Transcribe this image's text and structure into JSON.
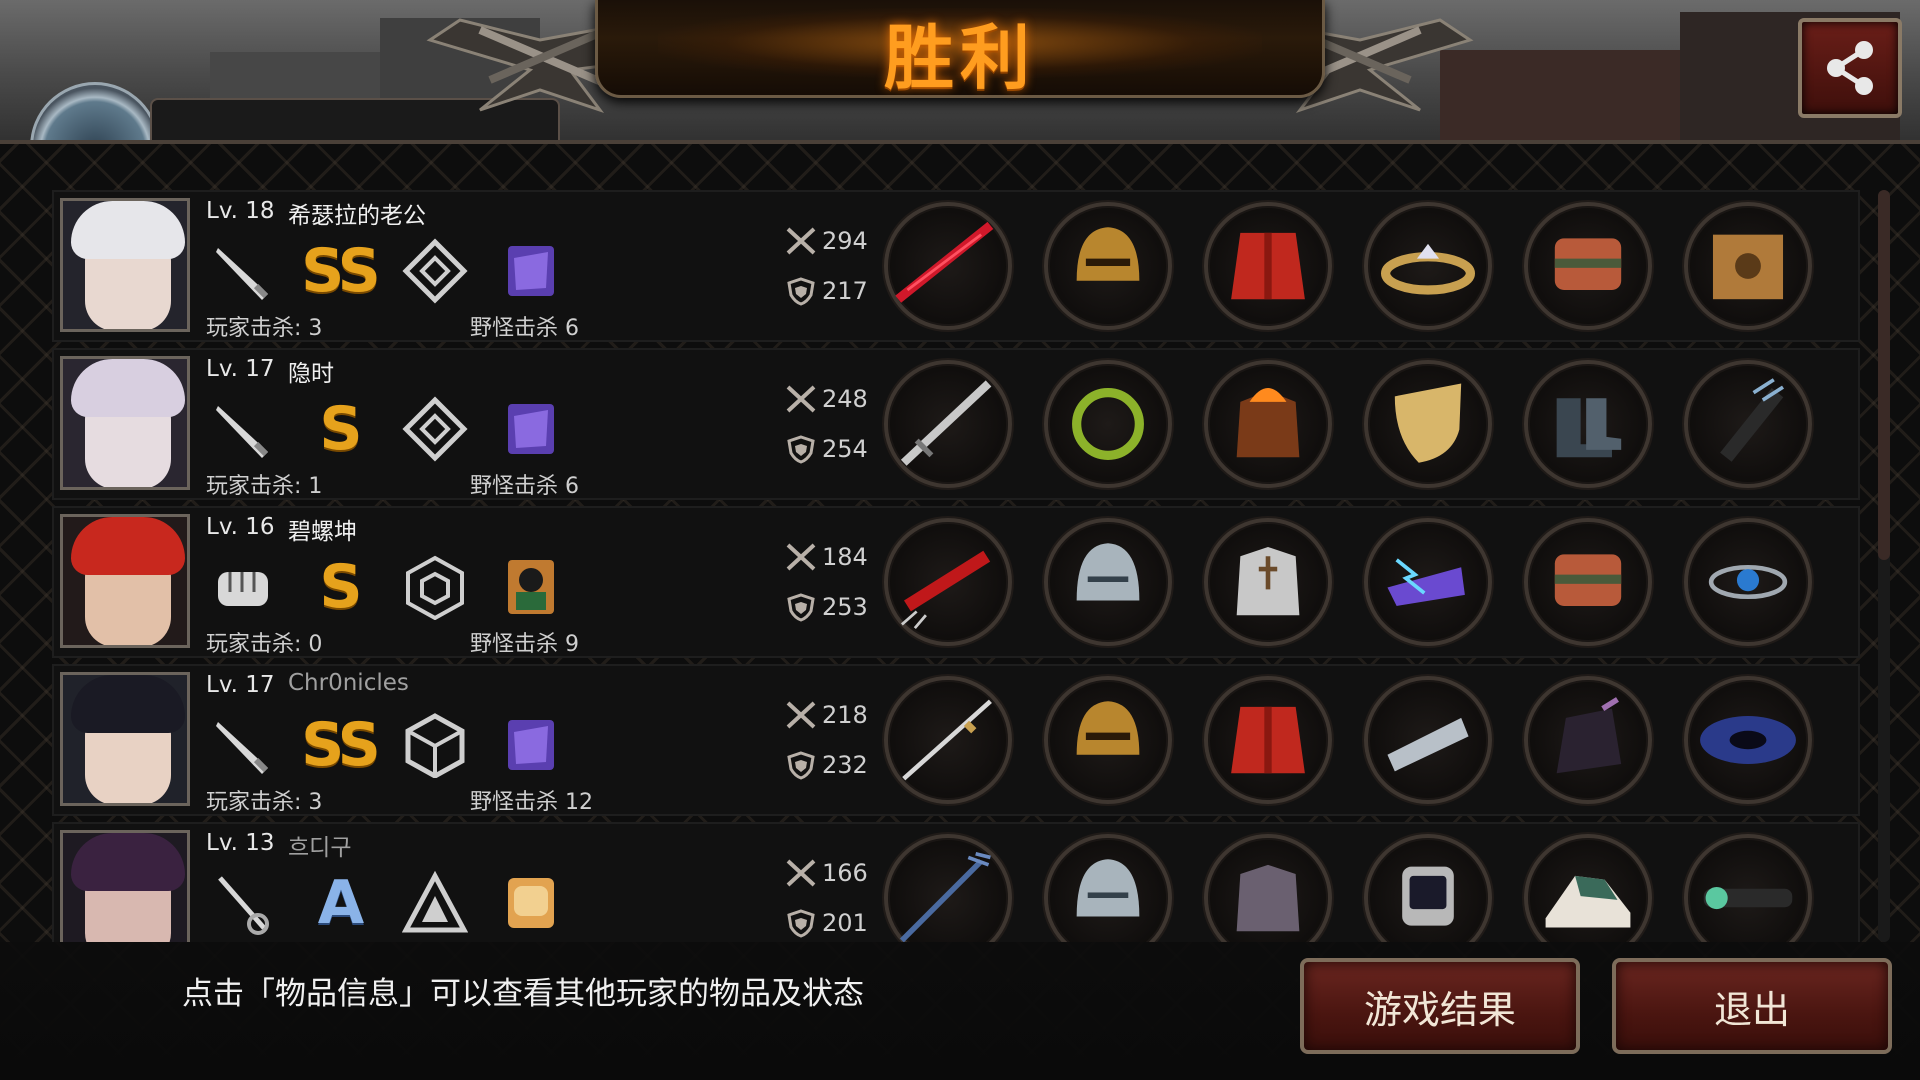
{
  "title": "胜利",
  "share_icon": "share-icon",
  "players": [
    {
      "level": "Lv. 18",
      "name": "希瑟拉的老公",
      "name_style": "normal",
      "weapon_icon": "knife-icon",
      "grade": "SS",
      "rank_icon": "diamond-rank-icon",
      "pet_icon": "purple-creature-icon",
      "player_kills": "玩家击杀: 3",
      "monster_kills": "野怪击杀 6",
      "attack": "294",
      "defense": "217",
      "items": [
        "crimson-blade-icon",
        "gold-helmet-icon",
        "red-jacket-icon",
        "tiara-icon",
        "gauntlet-icon",
        "cat-box-icon"
      ],
      "colors": {
        "face": "#e8d8d0",
        "hair": "#e6e6ea",
        "bg": "#24242c"
      }
    },
    {
      "level": "Lv. 17",
      "name": "隐时",
      "name_style": "normal",
      "weapon_icon": "knife-icon",
      "grade": "S",
      "rank_icon": "diamond-rank-icon",
      "pet_icon": "purple-creature-icon",
      "player_kills": "玩家击杀: 1",
      "monster_kills": "野怪击杀 6",
      "attack": "248",
      "defense": "254",
      "items": [
        "greatsword-icon",
        "laurel-wreath-icon",
        "flame-armor-icon",
        "gold-shield-icon",
        "boots-icon",
        "quiver-icon"
      ],
      "colors": {
        "face": "#e6dce0",
        "hair": "#d8cfe0",
        "bg": "#2a2630"
      }
    },
    {
      "level": "Lv. 16",
      "name": "碧螺坤",
      "name_style": "normal",
      "weapon_icon": "fist-icon",
      "grade": "S",
      "rank_icon": "hexagon-rank-icon",
      "pet_icon": "hero-card-icon",
      "player_kills": "玩家击杀: 0",
      "monster_kills": "野怪击杀 9",
      "attack": "184",
      "defense": "253",
      "items": [
        "red-claw-icon",
        "silver-helmet-icon",
        "plate-armor-icon",
        "lightning-dragon-icon",
        "gauntlet-icon",
        "sapphire-bracelet-icon"
      ],
      "colors": {
        "face": "#e2c0a8",
        "hair": "#c8281e",
        "bg": "#221a1a"
      }
    },
    {
      "level": "Lv. 17",
      "name": "Chr0nicles",
      "name_style": "alt",
      "weapon_icon": "knife-icon",
      "grade": "SS",
      "rank_icon": "cube-rank-icon",
      "pet_icon": "purple-creature-icon",
      "player_kills": "玩家击杀: 3",
      "monster_kills": "野怪击杀 12",
      "attack": "218",
      "defense": "232",
      "items": [
        "katana-icon",
        "gold-helmet-icon",
        "red-jacket-icon",
        "silver-bracer-icon",
        "dark-gauntlet-icon",
        "galaxy-icon"
      ],
      "colors": {
        "face": "#e8d2c4",
        "hair": "#1a1a24",
        "bg": "#20222a"
      }
    },
    {
      "level": "Lv. 13",
      "name": "흐디구",
      "name_style": "alt",
      "weapon_icon": "rapier-icon",
      "grade": "A",
      "rank_icon": "triangle-rank-icon",
      "pet_icon": "bread-icon",
      "player_kills": "",
      "monster_kills": "",
      "attack": "166",
      "defense": "201",
      "items": [
        "trident-icon",
        "silver-helmet-icon",
        "dark-armor-icon",
        "smartwatch-icon",
        "sneaker-icon",
        "scope-icon"
      ],
      "colors": {
        "face": "#d8b8b0",
        "hair": "#3a2240",
        "bg": "#1e1a22"
      }
    }
  ],
  "hint": "点击「物品信息」可以查看其他玩家的物品及状态",
  "buttons": {
    "results": "游戏结果",
    "exit": "退出"
  }
}
